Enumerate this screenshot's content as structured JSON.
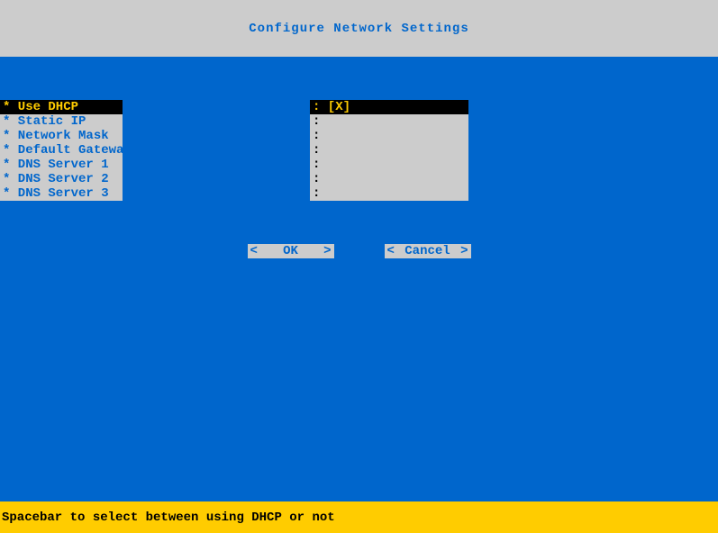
{
  "title": "Configure Network Settings",
  "menu": {
    "items": [
      {
        "label": "* Use DHCP",
        "selected": true
      },
      {
        "label": "* Static IP",
        "selected": false
      },
      {
        "label": "* Network Mask",
        "selected": false
      },
      {
        "label": "* Default Gateway",
        "selected": false
      },
      {
        "label": "* DNS Server 1",
        "selected": false
      },
      {
        "label": "* DNS Server 2",
        "selected": false
      },
      {
        "label": "* DNS Server 3",
        "selected": false
      }
    ]
  },
  "values": {
    "items": [
      {
        "label": ": [X]",
        "selected": true
      },
      {
        "label": ":",
        "selected": false
      },
      {
        "label": ":",
        "selected": false
      },
      {
        "label": ":",
        "selected": false
      },
      {
        "label": ":",
        "selected": false
      },
      {
        "label": ":",
        "selected": false
      },
      {
        "label": ":",
        "selected": false
      }
    ]
  },
  "buttons": {
    "ok": {
      "left": "<",
      "label": "OK",
      "right": ">"
    },
    "cancel": {
      "left": "<",
      "label": "Cancel",
      "right": ">"
    }
  },
  "footer": {
    "hint": "Spacebar to select between using DHCP or not"
  }
}
